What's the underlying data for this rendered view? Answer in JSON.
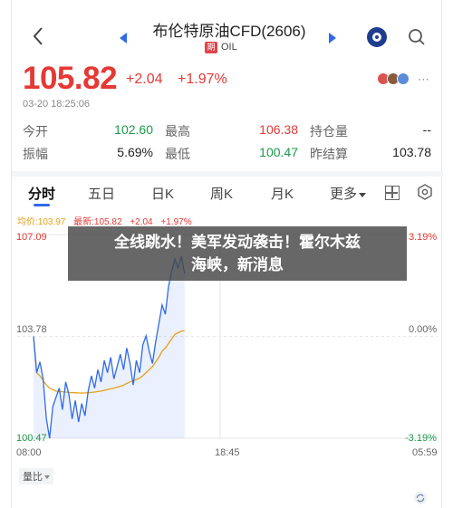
{
  "header": {
    "title": "布伦特原油CFD(2606)",
    "subtitle_badge": "期",
    "subtitle": "OIL"
  },
  "quote": {
    "price": "105.82",
    "change": "+2.04",
    "change_pct": "+1.97%",
    "timestamp": "03-20 18:25:06"
  },
  "stats": [
    {
      "l1": "今开",
      "v1": "102.60",
      "l2": "最高",
      "v2": "106.38",
      "l3": "持仓量",
      "v3": "--"
    },
    {
      "l1": "振幅",
      "v1": "5.69%",
      "l2": "最低",
      "v2": "100.47",
      "l3": "昨结算",
      "v3": "103.78"
    }
  ],
  "tabs": {
    "t1": "分时",
    "t2": "五日",
    "t3": "日K",
    "t4": "周K",
    "t5": "月K",
    "t6": "更多"
  },
  "legend": {
    "avg": "均价:103.97",
    "latest": "最新:105.82",
    "change": "+2.04",
    "pct": "+1.97%"
  },
  "chart_data": {
    "type": "line",
    "x_ticks": [
      "08:00",
      "18:45",
      "05:59"
    ],
    "y_left_ticks": [
      "107.09",
      "103.78",
      "100.47"
    ],
    "y_right_ticks": [
      "3.19%",
      "0.00%",
      "-3.19%"
    ],
    "ylim": [
      100.47,
      107.09
    ],
    "prev_settle": 103.78,
    "series": [
      {
        "values": [
          103.78,
          102.6,
          102.95,
          102.4,
          101.1,
          100.47,
          101.5,
          101.8,
          102.1,
          101.4,
          102.3,
          101.9,
          101.1,
          101.7,
          101.0,
          101.6,
          101.2,
          102.0,
          102.5,
          102.1,
          102.7,
          102.3,
          103.0,
          102.6,
          103.1,
          102.4,
          102.8,
          103.2,
          102.7,
          103.4,
          102.9,
          102.2,
          103.0,
          102.6,
          103.5,
          103.8,
          103.3,
          102.9,
          103.6,
          104.2,
          104.8,
          104.5,
          105.4,
          105.9,
          106.3,
          106.0,
          106.38,
          105.82
        ],
        "color": "#2f6ae8"
      },
      {
        "values": [
          103.78,
          102.6,
          102.5,
          102.35,
          102.2,
          102.1,
          102.05,
          102.0,
          102.0,
          101.98,
          101.97,
          101.96,
          101.95,
          101.95,
          101.94,
          101.94,
          101.94,
          101.95,
          101.96,
          101.97,
          101.99,
          102.0,
          102.03,
          102.05,
          102.08,
          102.1,
          102.13,
          102.16,
          102.2,
          102.25,
          102.3,
          102.34,
          102.38,
          102.42,
          102.5,
          102.6,
          102.7,
          102.8,
          102.95,
          103.1,
          103.3,
          103.4,
          103.55,
          103.7,
          103.85,
          103.9,
          103.95,
          103.97
        ],
        "color": "#e6a019"
      }
    ]
  },
  "volume_tab": "量比",
  "banner": {
    "line1": "全线跳水！美军发动袭击！霍尔木兹",
    "line2": "海峡，新消息"
  },
  "colors": {
    "up": "#e53935",
    "down": "#1a9b4a",
    "accent": "#2f6ae8",
    "avg_line": "#e6a019"
  }
}
